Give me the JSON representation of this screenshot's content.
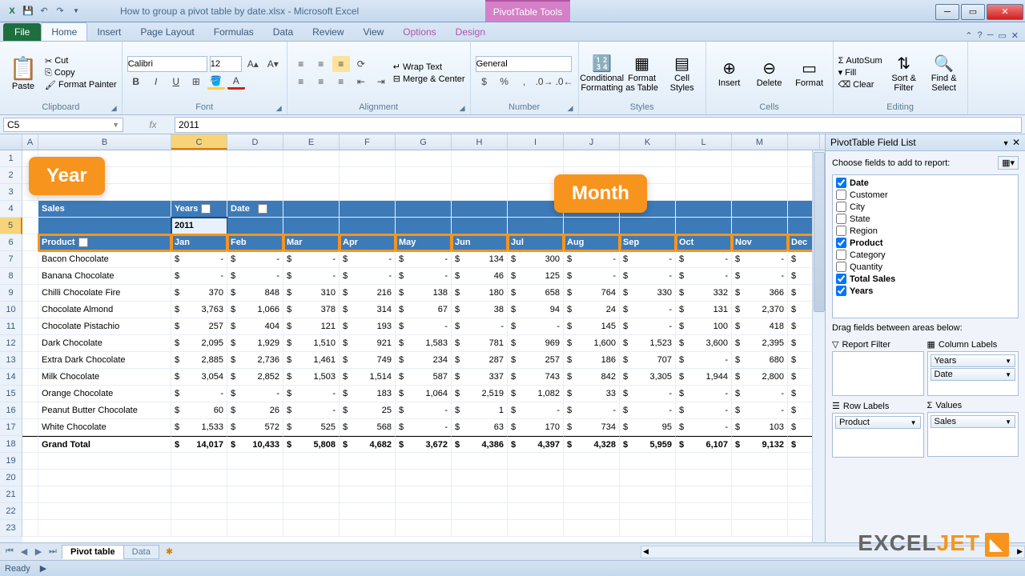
{
  "titlebar": {
    "file": "How to group a pivot table by date.xlsx - Microsoft Excel",
    "context": "PivotTable Tools"
  },
  "ribbon": {
    "fileTab": "File",
    "tabs": [
      "Home",
      "Insert",
      "Page Layout",
      "Formulas",
      "Data",
      "Review",
      "View",
      "Options",
      "Design"
    ],
    "activeTab": "Home",
    "clipboard": {
      "label": "Clipboard",
      "paste": "Paste",
      "cut": "Cut",
      "copy": "Copy",
      "fmt": "Format Painter"
    },
    "font": {
      "label": "Font",
      "name": "Calibri",
      "size": "12"
    },
    "alignment": {
      "label": "Alignment",
      "wrap": "Wrap Text",
      "merge": "Merge & Center"
    },
    "number": {
      "label": "Number",
      "format": "General"
    },
    "styles": {
      "label": "Styles",
      "cond": "Conditional\nFormatting",
      "fat": "Format\nas Table",
      "cell": "Cell\nStyles"
    },
    "cells": {
      "label": "Cells",
      "insert": "Insert",
      "delete": "Delete",
      "format": "Format"
    },
    "editing": {
      "label": "Editing",
      "autosum": "AutoSum",
      "fill": "Fill",
      "clear": "Clear",
      "sort": "Sort &\nFilter",
      "find": "Find &\nSelect"
    }
  },
  "namebox": "C5",
  "formula": "2011",
  "columns": [
    "A",
    "B",
    "C",
    "D",
    "E",
    "F",
    "G",
    "H",
    "I",
    "J",
    "K",
    "L",
    "M"
  ],
  "colwidths": {
    "A": 20,
    "B": 166,
    "C": 70,
    "D": 70,
    "E": 70,
    "F": 70,
    "G": 70,
    "H": 70,
    "I": 70,
    "J": 70,
    "K": 70,
    "L": 70,
    "M": 70,
    "N": 40
  },
  "selectedCol": "C",
  "selectedRow": 5,
  "pivot": {
    "salesLabel": "Sales",
    "yearsLabel": "Years",
    "dateLabel": "Date",
    "productLabel": "Product",
    "year": "2011",
    "months": [
      "Jan",
      "Feb",
      "Mar",
      "Apr",
      "May",
      "Jun",
      "Jul",
      "Aug",
      "Sep",
      "Oct",
      "Nov",
      "Dec"
    ],
    "rows": [
      {
        "p": "Bacon Chocolate",
        "v": [
          "-",
          "-",
          "-",
          "-",
          "-",
          "134",
          "300",
          "-",
          "-",
          "-",
          "-",
          ""
        ]
      },
      {
        "p": "Banana Chocolate",
        "v": [
          "-",
          "-",
          "-",
          "-",
          "-",
          "46",
          "125",
          "-",
          "-",
          "-",
          "-",
          ""
        ]
      },
      {
        "p": "Chilli Chocolate Fire",
        "v": [
          "370",
          "848",
          "310",
          "216",
          "138",
          "180",
          "658",
          "764",
          "330",
          "332",
          "366",
          ""
        ]
      },
      {
        "p": "Chocolate Almond",
        "v": [
          "3,763",
          "1,066",
          "378",
          "314",
          "67",
          "38",
          "94",
          "24",
          "-",
          "131",
          "2,370",
          ""
        ]
      },
      {
        "p": "Chocolate Pistachio",
        "v": [
          "257",
          "404",
          "121",
          "193",
          "-",
          "-",
          "-",
          "145",
          "-",
          "100",
          "418",
          ""
        ]
      },
      {
        "p": "Dark Chocolate",
        "v": [
          "2,095",
          "1,929",
          "1,510",
          "921",
          "1,583",
          "781",
          "969",
          "1,600",
          "1,523",
          "3,600",
          "2,395",
          ""
        ]
      },
      {
        "p": "Extra Dark Chocolate",
        "v": [
          "2,885",
          "2,736",
          "1,461",
          "749",
          "234",
          "287",
          "257",
          "186",
          "707",
          "-",
          "680",
          ""
        ]
      },
      {
        "p": "Milk Chocolate",
        "v": [
          "3,054",
          "2,852",
          "1,503",
          "1,514",
          "587",
          "337",
          "743",
          "842",
          "3,305",
          "1,944",
          "2,800",
          ""
        ]
      },
      {
        "p": "Orange Chocolate",
        "v": [
          "-",
          "-",
          "-",
          "183",
          "1,064",
          "2,519",
          "1,082",
          "33",
          "-",
          "-",
          "-",
          ""
        ]
      },
      {
        "p": "Peanut Butter Chocolate",
        "v": [
          "60",
          "26",
          "-",
          "25",
          "-",
          "1",
          "-",
          "-",
          "-",
          "-",
          "-",
          ""
        ]
      },
      {
        "p": "White Chocolate",
        "v": [
          "1,533",
          "572",
          "525",
          "568",
          "-",
          "63",
          "170",
          "734",
          "95",
          "-",
          "103",
          ""
        ]
      }
    ],
    "grandTotal": {
      "label": "Grand Total",
      "v": [
        "14,017",
        "10,433",
        "5,808",
        "4,682",
        "3,672",
        "4,386",
        "4,397",
        "4,328",
        "5,959",
        "6,107",
        "9,132",
        ""
      ]
    }
  },
  "callouts": {
    "year": "Year",
    "month": "Month"
  },
  "fieldlist": {
    "title": "PivotTable Field List",
    "choose": "Choose fields to add to report:",
    "fields": [
      {
        "name": "Date",
        "checked": true
      },
      {
        "name": "Customer",
        "checked": false
      },
      {
        "name": "City",
        "checked": false
      },
      {
        "name": "State",
        "checked": false
      },
      {
        "name": "Region",
        "checked": false
      },
      {
        "name": "Product",
        "checked": true
      },
      {
        "name": "Category",
        "checked": false
      },
      {
        "name": "Quantity",
        "checked": false
      },
      {
        "name": "Total Sales",
        "checked": true
      },
      {
        "name": "Years",
        "checked": true
      }
    ],
    "drag": "Drag fields between areas below:",
    "areas": {
      "reportFilter": {
        "title": "Report Filter",
        "items": []
      },
      "columnLabels": {
        "title": "Column Labels",
        "items": [
          "Years",
          "Date"
        ]
      },
      "rowLabels": {
        "title": "Row Labels",
        "items": [
          "Product"
        ]
      },
      "values": {
        "title": "Values",
        "items": [
          "Sales"
        ]
      }
    }
  },
  "sheettabs": {
    "active": "Pivot table",
    "tabs": [
      "Pivot table",
      "Data"
    ]
  },
  "status": "Ready",
  "logo": "EXCELJET"
}
